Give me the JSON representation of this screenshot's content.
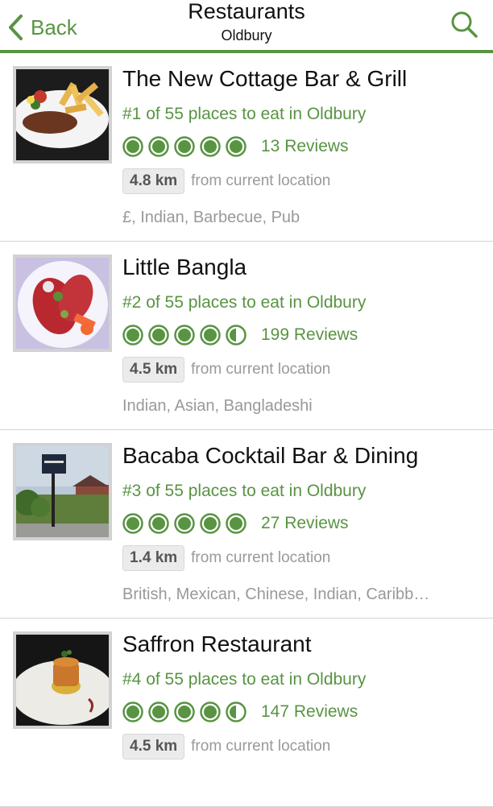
{
  "nav": {
    "back_label": "Back",
    "title": "Restaurants",
    "subtitle": "Oldbury",
    "search_icon": "search-icon",
    "back_icon": "chevron-left-icon"
  },
  "colors": {
    "accent": "#589442",
    "muted_text": "#999999",
    "divider": "#d4d4d4"
  },
  "restaurants": [
    {
      "name": "The New Cottage Bar & Grill",
      "rank": "#1 of 55 places to eat in Oldbury",
      "rating": 5,
      "reviews": "13 Reviews",
      "distance": "4.8 km",
      "distance_label": "from current location",
      "cuisine": "£, Indian, Barbecue, Pub"
    },
    {
      "name": "Little Bangla",
      "rank": "#2 of 55 places to eat in Oldbury",
      "rating": 4.5,
      "reviews": "199 Reviews",
      "distance": "4.5 km",
      "distance_label": "from current location",
      "cuisine": "Indian, Asian, Bangladeshi"
    },
    {
      "name": "Bacaba Cocktail Bar & Dining",
      "rank": "#3 of 55 places to eat in Oldbury",
      "rating": 5,
      "reviews": "27 Reviews",
      "distance": "1.4 km",
      "distance_label": "from current location",
      "cuisine": "British, Mexican, Chinese, Indian, Caribb…"
    },
    {
      "name": "Saffron Restaurant",
      "rank": "#4 of 55 places to eat in Oldbury",
      "rating": 4.5,
      "reviews": "147 Reviews",
      "distance": "4.5 km",
      "distance_label": "from current location",
      "cuisine": ""
    }
  ]
}
